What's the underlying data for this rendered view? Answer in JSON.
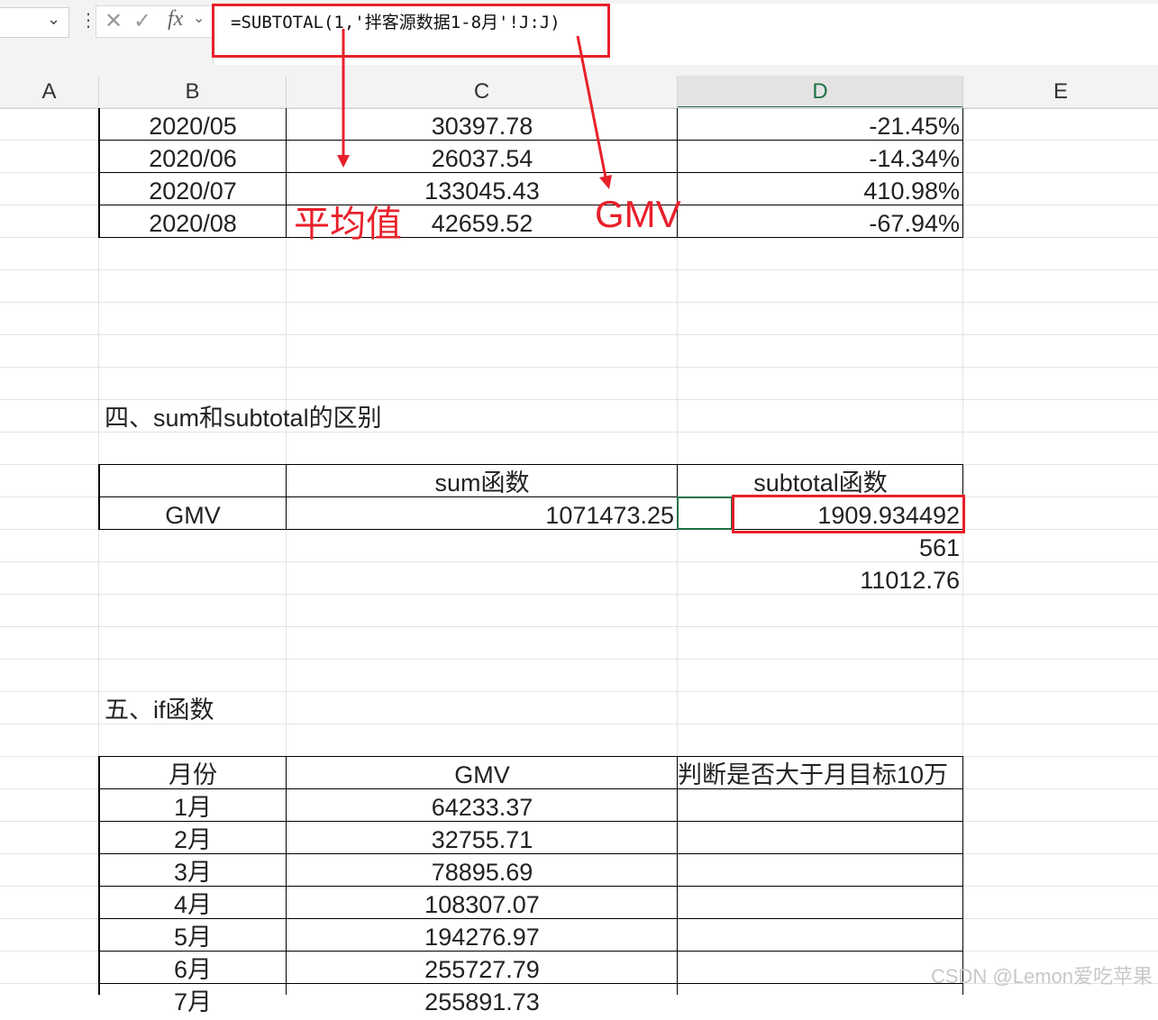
{
  "formula_bar": {
    "formula": "=SUBTOTAL(1,'拌客源数据1-8月'!J:J)"
  },
  "columns": [
    "A",
    "B",
    "C",
    "D",
    "E"
  ],
  "table1": {
    "rows": [
      {
        "month": "2020/05",
        "gmv": "30397.78",
        "change": "-21.45%"
      },
      {
        "month": "2020/06",
        "gmv": "26037.54",
        "change": "-14.34%"
      },
      {
        "month": "2020/07",
        "gmv": "133045.43",
        "change": "410.98%"
      },
      {
        "month": "2020/08",
        "gmv": "42659.52",
        "change": "-67.94%"
      }
    ]
  },
  "annotations": {
    "average_label": "平均值",
    "gmv_label": "GMV",
    "accent_color": "#e8202a"
  },
  "section4": {
    "title": "四、sum和subtotal的区别",
    "header_sum": "sum函数",
    "header_subtotal": "subtotal函数",
    "row_label": "GMV",
    "sum_value": "1071473.25",
    "subtotal_value": "1909.934492",
    "extra_value_1": "561",
    "extra_value_2": "11012.76"
  },
  "section5": {
    "title": "五、if函数",
    "header_month": "月份",
    "header_gmv": "GMV",
    "header_judge": "判断是否大于月目标10万",
    "rows": [
      {
        "month": "1月",
        "gmv": "64233.37"
      },
      {
        "month": "2月",
        "gmv": "32755.71"
      },
      {
        "month": "3月",
        "gmv": "78895.69"
      },
      {
        "month": "4月",
        "gmv": "108307.07"
      },
      {
        "month": "5月",
        "gmv": "194276.97"
      },
      {
        "month": "6月",
        "gmv": "255727.79"
      },
      {
        "month": "7月",
        "gmv": "255891.73"
      }
    ]
  },
  "watermark": "CSDN @Lemon爱吃苹果"
}
